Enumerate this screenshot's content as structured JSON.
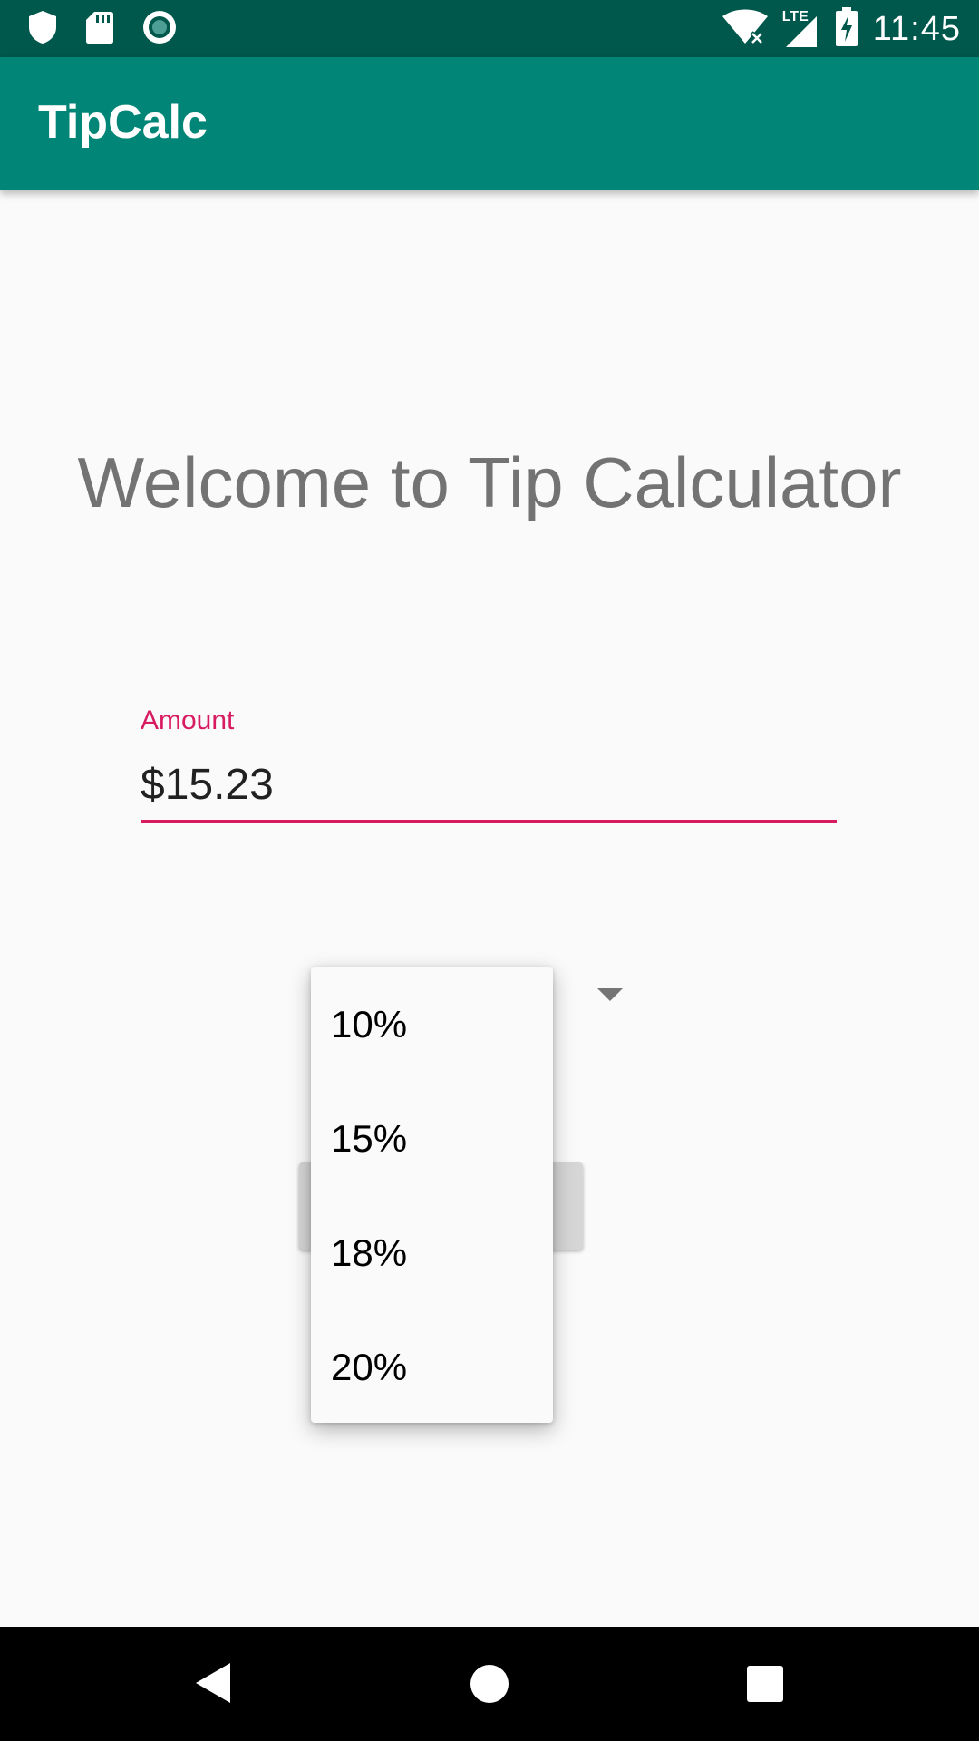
{
  "status_bar": {
    "time": "11:45",
    "network_label": "LTE",
    "left_icons": [
      "shield-icon",
      "sd-card-icon",
      "record-icon"
    ],
    "right_icons": [
      "wifi-icon",
      "cell-signal-icon",
      "battery-charging-icon"
    ]
  },
  "app_bar": {
    "title": "TipCalc"
  },
  "main": {
    "welcome_text": "Welcome to Tip Calculator",
    "amount_field": {
      "label": "Amount",
      "value": "$15.23"
    },
    "tip_dropdown": {
      "options": [
        "10%",
        "15%",
        "18%",
        "20%"
      ]
    }
  },
  "nav_bar": {
    "buttons": [
      "back-icon",
      "home-icon",
      "recents-icon"
    ]
  },
  "colors": {
    "status_bar": "#00574b",
    "app_bar": "#008577",
    "accent": "#d81b60",
    "background": "#fafafa"
  }
}
